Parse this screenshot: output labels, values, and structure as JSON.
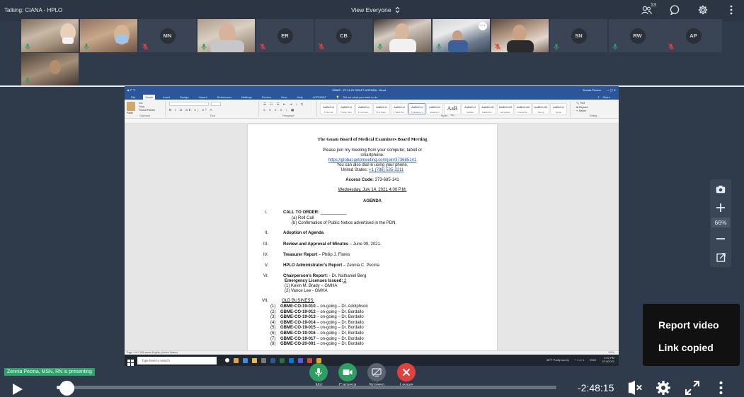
{
  "topbar": {
    "talking": "Talking: CIANA - HPLO",
    "view_mode": "View Everyone",
    "participant_count": "13"
  },
  "participants": [
    {
      "initials": "",
      "mic": "on"
    },
    {
      "initials": "",
      "mic": "on"
    },
    {
      "initials": "MN",
      "mic": "muted"
    },
    {
      "initials": "",
      "mic": "on"
    },
    {
      "initials": "ER",
      "mic": "muted"
    },
    {
      "initials": "CB",
      "mic": "muted"
    },
    {
      "initials": "",
      "mic": "on"
    },
    {
      "initials": "",
      "mic": "on"
    },
    {
      "initials": "",
      "mic": "muted"
    },
    {
      "initials": "SN",
      "mic": "on"
    },
    {
      "initials": "RW",
      "mic": "on"
    },
    {
      "initials": "AP",
      "mic": "muted"
    },
    {
      "initials": "",
      "mic": "on"
    }
  ],
  "word": {
    "title": "GBME - 07.14.21 DRAFT AGENDA - Word",
    "user": "Zennia Pecina",
    "share": "Share",
    "tabs": [
      "File",
      "Home",
      "Insert",
      "Design",
      "Layout",
      "References",
      "Mailings",
      "Review",
      "View",
      "Help",
      "ACROBAT"
    ],
    "tell_me": "Tell me what you want to do",
    "font": "Arial",
    "font_size": "10",
    "clipboard": "Clipboard",
    "font_group": "Font",
    "paragraph_group": "Paragraph",
    "styles_group": "Styles",
    "editing_group": "Editing",
    "paste": "Paste",
    "cut": "Cut",
    "copy": "Copy",
    "format_painter": "Format Painter",
    "find": "Find",
    "replace": "Replace",
    "select": "Select",
    "styles": [
      {
        "sample": "AaBbCcI",
        "name": "¶ Normal"
      },
      {
        "sample": "AaBbCcI",
        "name": "¶ Body Text"
      },
      {
        "sample": "AaBbCcI",
        "name": "¶ List Para..."
      },
      {
        "sample": "AaBbCcI",
        "name": "¶ No Spac..."
      },
      {
        "sample": "AaBbCcI",
        "name": "¶ Table Pa..."
      },
      {
        "sample": "AaBbCcI",
        "name": "¶ Heading 1"
      },
      {
        "sample": "AaBbCcI",
        "name": "Heading 2"
      },
      {
        "sample": "AaB",
        "name": "Title"
      },
      {
        "sample": "AaBbCcI",
        "name": "Subtitle"
      },
      {
        "sample": "AaBbCcD",
        "name": "Subtle Em..."
      },
      {
        "sample": "AaBbCcDi",
        "name": "Emphasis"
      },
      {
        "sample": "AaBbCcDi",
        "name": "Intense E..."
      },
      {
        "sample": "AaBbCcDi",
        "name": "Strong"
      },
      {
        "sample": "AaBbCcI",
        "name": "Quote"
      }
    ],
    "status": "Page 1 of 2   359 words   English (United States)",
    "zoom_status": "110%"
  },
  "document": {
    "heading": "The Guam Board of Medical Examiners Board Meeting",
    "intro_1": "Please join my meeting from your computer, tablet or",
    "intro_2": "smartphone.",
    "link": "https://global.gotomeeting.com/join/373685141",
    "phone_intro": "You can also dial in using your phone.",
    "phone_label": "United States: ",
    "phone": "+1 (786) 535-3211",
    "access_label": "Access Code:",
    "access_code": " 373-685-141",
    "date": "Wednesday, July 14, 2021 4:00 P.M.",
    "agenda": "AGENDA",
    "items": [
      {
        "num": "I.",
        "title": "CALL TO ORDER:",
        "rest": " ___________"
      },
      {
        "num": "II.",
        "title": "Adoption of Agenda",
        "rest": ""
      },
      {
        "num": "III.",
        "title": "Review and Approval of Minutes",
        "rest": " – June 09, 2021."
      },
      {
        "num": "IV.",
        "title": "Treasurer Report",
        "rest": " – Philip J. Flores"
      },
      {
        "num": "V.",
        "title": "HPLO Administrator's Report",
        "rest": " – Zennia C. Pecina"
      },
      {
        "num": "VI.",
        "title": "Chairperson's Report:",
        "rest": " - Dr. Nathaniel Berg"
      },
      {
        "num": "VII.",
        "title": "OLD BUSINESS:",
        "rest": ""
      }
    ],
    "roll_call": "(a) Roll Call",
    "confirmation": "(b) Confirmation of Public Notice advertised in the PDN.",
    "emergency_label": "Emergency Licenses Issued:",
    "emergency_count": " 2",
    "licensee_1": "(1)  Kevin M. Brady – GMHA",
    "licensee_2": "(2)  Vance Lee - GMHA",
    "old_business": [
      {
        "num": "(1)",
        "code": "GBME-CO-19-010",
        "rest": " – on-going – Dr. Adolphson"
      },
      {
        "num": "(2)",
        "code": "GBME-CO-19-012",
        "rest": " – on-going – Dr. Bordallo"
      },
      {
        "num": "(3)",
        "code": "GBME-CO-19-013",
        "rest": " – on-going – Dr. Bordallo"
      },
      {
        "num": "(4)",
        "code": "GBME-CO-19-014",
        "rest": " – on-going – Dr. Bordallo"
      },
      {
        "num": "(5)",
        "code": "GBME-CO-19-015",
        "rest": " – on-going – Dr. Bordallo"
      },
      {
        "num": "(6)",
        "code": "GBME-CO-19-016",
        "rest": " – on-going – Dr. Bordallo"
      },
      {
        "num": "(7)",
        "code": "GBME-CO-19-017",
        "rest": " – on-going – Dr. Bordallo"
      },
      {
        "num": "(8)",
        "code": "GBME-CO-20-001",
        "rest": " – on-going – Dr. Bordallo"
      }
    ]
  },
  "taskbar": {
    "search": "Type here to search",
    "weather": "88°F  Partly sunny",
    "lang": "ENG",
    "time": "4:00 PM",
    "date": "7/14/2021"
  },
  "zoom": {
    "percent": "66%"
  },
  "toast": {
    "line1": "Report video",
    "line2": "Link copied"
  },
  "presenting": "Zennia Pecina, MSN, RN is presenting",
  "controls": {
    "mic": "Mic",
    "camera": "Camera",
    "screen": "Screen",
    "leave": "Leave"
  },
  "player": {
    "time": "-2:48:15",
    "progress": 0.02
  },
  "colors": {
    "mic_green": "#2e9e63",
    "leave_red": "#e0413f",
    "word_blue": "#2b579a"
  }
}
